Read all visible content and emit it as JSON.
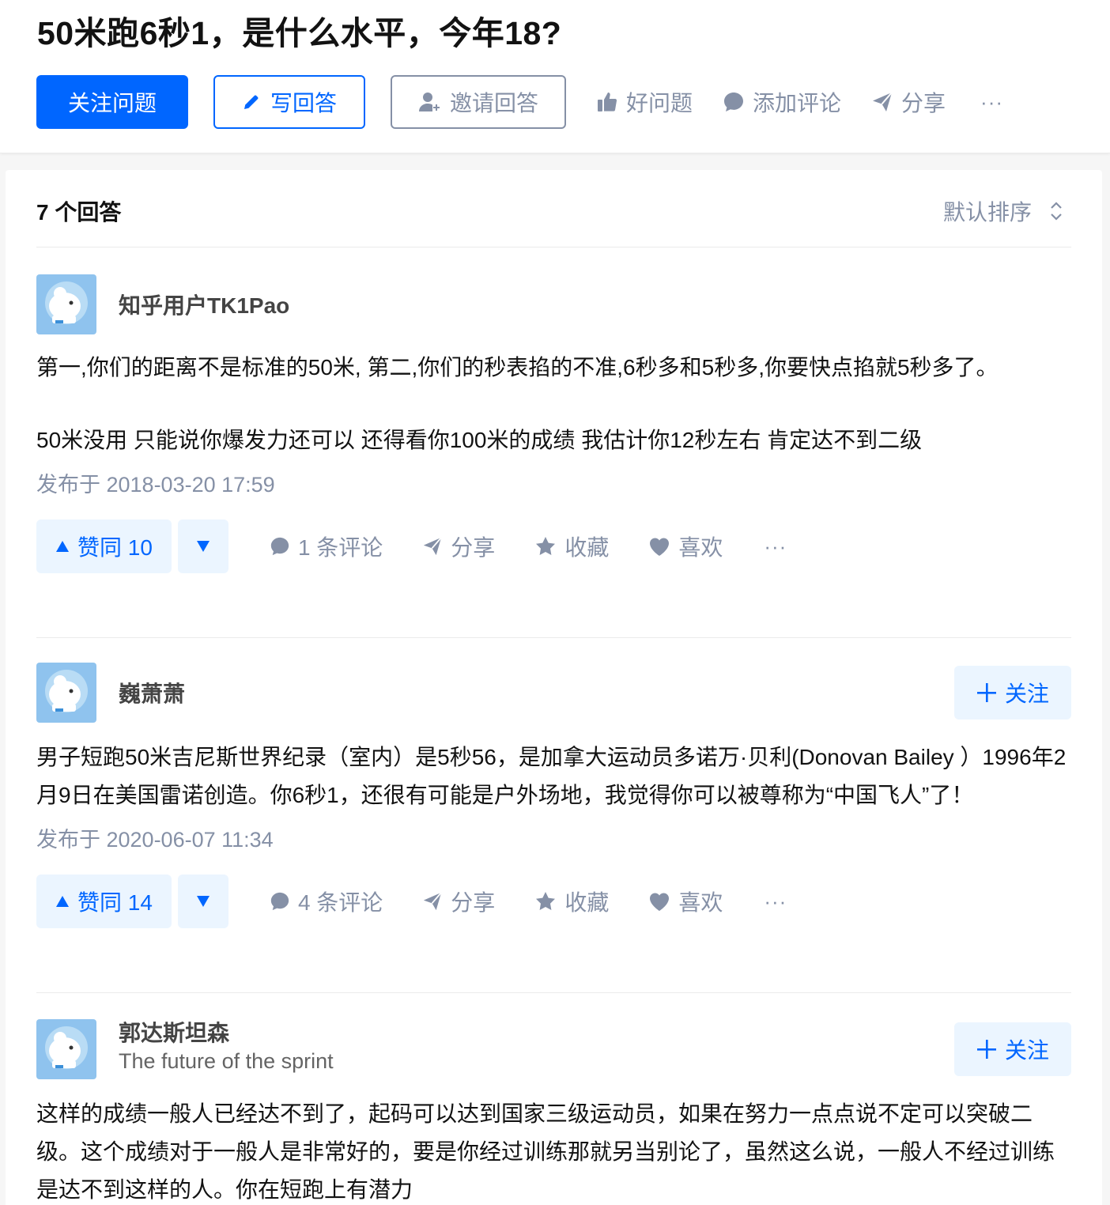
{
  "question": {
    "title": "50米跑6秒1，是什么水平，今年18?",
    "follow_label": "关注问题",
    "write_label": "写回答",
    "invite_label": "邀请回答",
    "good_label": "好问题",
    "comment_label": "添加评论",
    "share_label": "分享",
    "more_label": "···"
  },
  "answers_header": {
    "count_label": "7 个回答",
    "sort_label": "默认排序"
  },
  "colors": {
    "accent": "#0066ff",
    "muted": "#8590a6",
    "accent_bg": "#ebf5ff"
  },
  "answers": [
    {
      "author": "知乎用户TK1Pao",
      "paragraphs": [
        "第一,你们的距离不是标准的50米, 第二,你们的秒表掐的不准,6秒多和5秒多,你要快点掐就5秒多了。",
        "50米没用 只能说你爆发力还可以 还得看你100米的成绩 我估计你12秒左右 肯定达不到二级"
      ],
      "published": "发布于 2018-03-20 17:59",
      "vote_label": "赞同 10",
      "comments_label": "1 条评论",
      "share_label": "分享",
      "collect_label": "收藏",
      "like_label": "喜欢",
      "more_label": "···"
    },
    {
      "author": "巍萧萧",
      "follow_label": "关注",
      "paragraphs": [
        "男子短跑50米吉尼斯世界纪录（室内）是5秒56，是加拿大运动员多诺万·贝利(Donovan Bailey ）1996年2月9日在美国雷诺创造。你6秒1，还很有可能是户外场地，我觉得你可以被尊称为“中国飞人”了！"
      ],
      "published": "发布于 2020-06-07 11:34",
      "vote_label": "赞同 14",
      "comments_label": "4 条评论",
      "share_label": "分享",
      "collect_label": "收藏",
      "like_label": "喜欢",
      "more_label": "···"
    },
    {
      "author": "郭达斯坦森",
      "bio": "The future of the sprint",
      "follow_label": "关注",
      "paragraphs": [
        "这样的成绩一般人已经达不到了，起码可以达到国家三级运动员，如果在努力一点点说不定可以突破二级。这个成绩对于一般人是非常好的，要是你经过训练那就另当别论了，虽然这么说，一般人不经过训练是达不到这样的人。你在短跑上有潜力"
      ]
    }
  ]
}
